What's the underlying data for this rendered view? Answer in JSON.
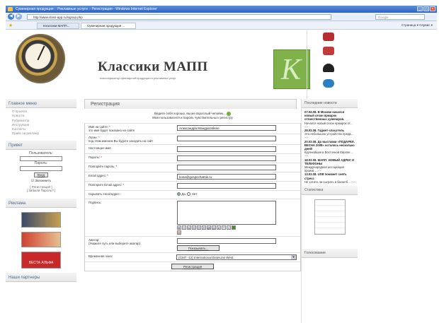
{
  "window": {
    "title": "Сувенирная продукция :: Рекламные услуги :: Регистрация - Windows Internet Explorer"
  },
  "address": {
    "url": "http://www.class-app.ru/signup.php",
    "search_placeholder": "Google"
  },
  "tabs": [
    {
      "label": "Классики МАПП..."
    },
    {
      "label": "Сувенирная продукция ..."
    }
  ],
  "toolbar": {
    "tools_text": "Страница ▾  Сервис ▾"
  },
  "header": {
    "logo": "Классики МАПП",
    "tagline": "классификатор сувенирной продукции и рекламных услуг",
    "logo_letter": "K"
  },
  "left": {
    "menu_title": "Главное меню",
    "menu": [
      "О проекте",
      "Новости",
      "Рубрикатор",
      "Инструкция",
      "Контакты",
      "Прайс на рекламу"
    ],
    "login_title": "Привет",
    "user_label": "Пользователь:",
    "pass_label": "Пароль:",
    "login_btn": "Вход",
    "remember": "Запомнить",
    "reg_links": "[ Регистрация ]\n[ Забыли Пароль? ]",
    "ads_title": "Реклама",
    "ad3": "ВЕСТА АЛЬФА",
    "partners_title": "Наши партнеры"
  },
  "main": {
    "title": "Регистрация",
    "notice1": "Ведите себя хорошо, вы же взрослый человек...",
    "notice2": "Имя пользователя и пароль чувствительны к регистру",
    "rows": [
      {
        "label": "Имя на сайте:",
        "hint": "это имя будет показано на сайте",
        "value": "Александра Мандрагабеле"
      },
      {
        "label": "Логин:",
        "hint": "под этим именем Вы будете заходить на сайт",
        "value": ""
      },
      {
        "label": "Настоящее имя:",
        "hint": "",
        "value": ""
      },
      {
        "label": "Пароль:",
        "hint": "",
        "value": ""
      },
      {
        "label": "Повторите пароль:",
        "hint": "",
        "value": ""
      },
      {
        "label": "Email адрес:",
        "hint": "",
        "value": "bosa@gospechatnik.ru"
      },
      {
        "label": "Повторите Email адрес:",
        "hint": "",
        "value": ""
      }
    ],
    "hide_email_label": "Скрывать email адрес:",
    "yes": "Да",
    "no": "Нет",
    "signature_label": "Подпись:",
    "avatar_label": "Аватар:",
    "avatar_hint": "(Укажите путь или выберите аватар)",
    "avatar_btn": "Показывать...",
    "tz_label": "Временная зона:",
    "tz_value": "(GMT -12) International DateLine West",
    "submit": "Регистрация"
  },
  "right": {
    "news_title": "Последние новости",
    "news": [
      {
        "title": "07.04.08. В Москве начался новый сезон ярмарок отечественных сувениров.",
        "text": "Начался новый сезон ярмарок от..."
      },
      {
        "title": "28.03.08. Гаджет-спасатель",
        "text": "Это небольшое устройство предв..."
      },
      {
        "title": "20.03.08. До выставки «ПОДАРКИ. ВЕСНА 2008» осталось несколько дней!",
        "text": "Крупнейшая в Восточной Европе ..."
      },
      {
        "title": "18.03.08. МАПП: НОВЫЙ АДРЕС И ТЕЛЕФОНЫ",
        "text": "Международная ассоциация произв..."
      },
      {
        "title": "13.03.08. USB поможет снять стресс",
        "text": "Не хотите ли сыграть в баскетб..."
      }
    ],
    "more": ">>",
    "stats_title": "Статистика",
    "vote_title": "Голосование"
  },
  "colors": {
    "accent_green": "#7fb24a",
    "ie_blue": "#2f62c2"
  }
}
